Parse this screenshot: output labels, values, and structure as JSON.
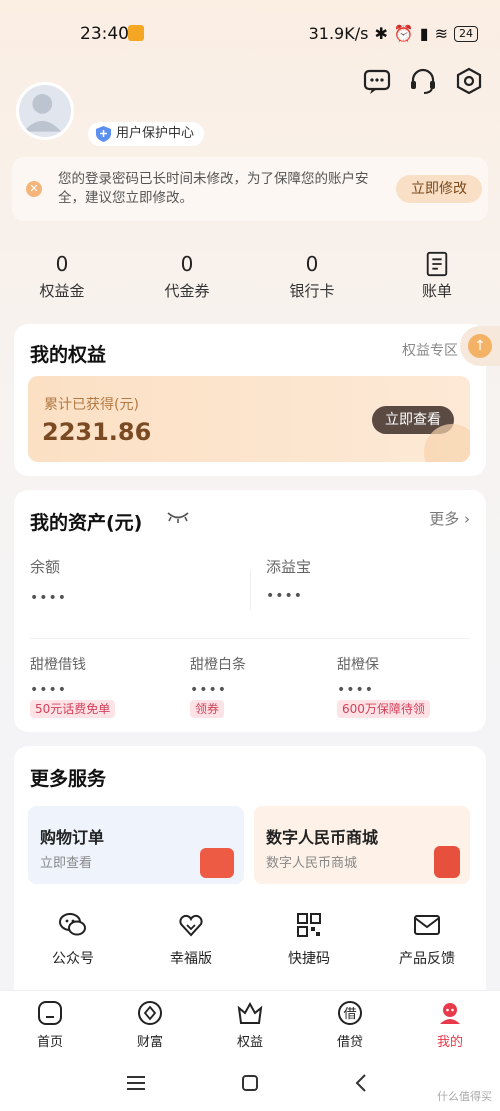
{
  "status_bar": {
    "time": "23:40",
    "network_speed": "31.9K/s",
    "battery": "24"
  },
  "profile": {
    "protection_center": "用户保护中心"
  },
  "notice": {
    "text": "您的登录密码已长时间未修改，为了保障您的账户安全，建议您立即修改。",
    "action": "立即修改"
  },
  "stats": [
    {
      "value": "0",
      "label": "权益金"
    },
    {
      "value": "0",
      "label": "代金券"
    },
    {
      "value": "0",
      "label": "银行卡"
    },
    {
      "value": "",
      "label": "账单"
    }
  ],
  "rights": {
    "title": "我的权益",
    "zone_link": "权益专区",
    "earned_label": "累计已获得(元)",
    "earned_value": "2231.86",
    "view_button": "立即查看"
  },
  "assets": {
    "title": "我的资产(元)",
    "more": "更多",
    "balance_label": "余额",
    "balance_value": "••••",
    "tianyibao_label": "添益宝",
    "tianyibao_value": "••••",
    "items": [
      {
        "label": "甜橙借钱",
        "value": "••••",
        "tag": "50元话费免单"
      },
      {
        "label": "甜橙白条",
        "value": "••••",
        "tag": "领券"
      },
      {
        "label": "甜橙保",
        "value": "••••",
        "tag": "600万保障待领"
      }
    ]
  },
  "services": {
    "title": "更多服务",
    "boxes": [
      {
        "title": "购物订单",
        "subtitle": "立即查看"
      },
      {
        "title": "数字人民币商城",
        "subtitle": "数字人民币商城"
      }
    ],
    "quick": [
      {
        "label": "公众号",
        "icon": "wechat-icon"
      },
      {
        "label": "幸福版",
        "icon": "hearts-icon"
      },
      {
        "label": "快捷码",
        "icon": "qr-code-icon"
      },
      {
        "label": "产品反馈",
        "icon": "mail-icon"
      }
    ]
  },
  "tabbar": [
    {
      "label": "首页",
      "icon": "home-icon"
    },
    {
      "label": "财富",
      "icon": "wealth-icon"
    },
    {
      "label": "权益",
      "icon": "crown-icon"
    },
    {
      "label": "借贷",
      "icon": "loan-icon"
    },
    {
      "label": "我的",
      "icon": "profile-icon",
      "active": true
    }
  ],
  "watermark": "什么值得买",
  "colors": {
    "accent": "#e83a4b",
    "gold": "#7a4a22",
    "tag_red": "#d4415b"
  }
}
